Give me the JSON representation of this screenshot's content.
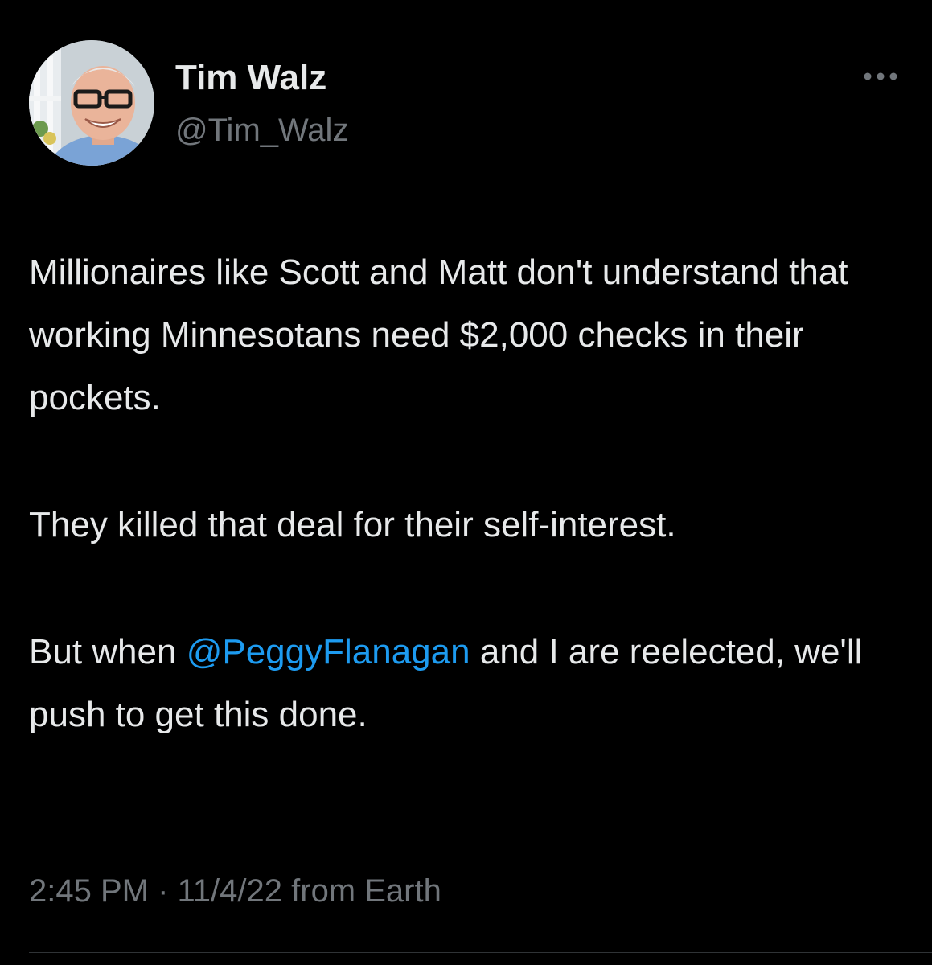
{
  "author": {
    "name": "Tim Walz",
    "handle": "@Tim_Walz"
  },
  "tweet": {
    "paragraph1": "Millionaires like Scott and Matt don't understand that working Minnesotans need $2,000 checks in their pockets.",
    "paragraph2": "They killed that deal for their self-interest.",
    "paragraph3_before": "But when ",
    "paragraph3_mention": "@PeggyFlanagan",
    "paragraph3_after": " and I are reelected, we'll push to get this done."
  },
  "meta": {
    "time": "2:45 PM",
    "separator": " · ",
    "date": "11/4/22",
    "source": " from Earth"
  },
  "icons": {
    "more": "more-horizontal-icon"
  },
  "colors": {
    "background": "#000000",
    "text": "#e7e9ea",
    "secondary": "#71767b",
    "mention": "#1d9bf0"
  }
}
